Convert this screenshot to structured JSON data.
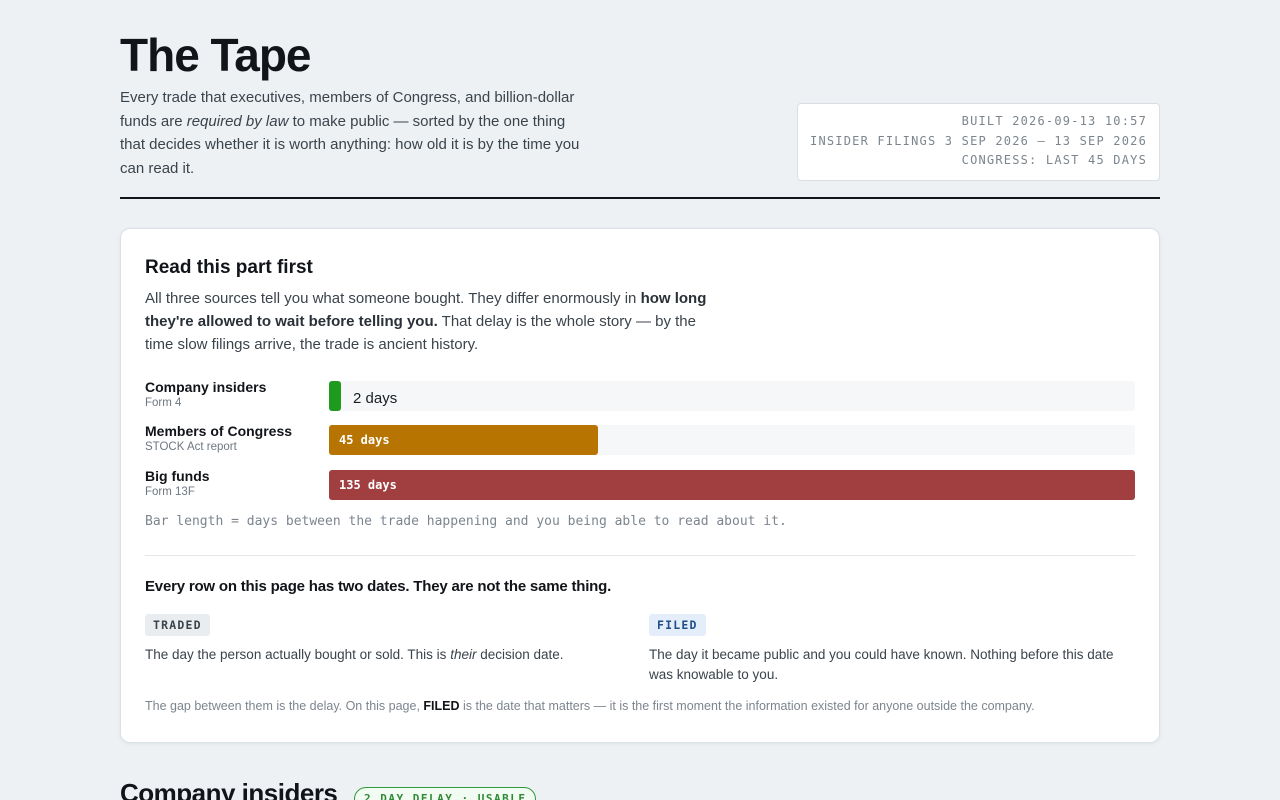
{
  "header": {
    "title": "The Tape",
    "intro_a": "Every trade that executives, members of Congress, and billion-dollar funds are ",
    "intro_em": "required by law",
    "intro_b": " to make public — sorted by the one thing that decides whether it is worth anything: how old it is by the time you can read it.",
    "meta_built": "BUILT 2026-09-13 10:57",
    "meta_insider": "INSIDER FILINGS 3 SEP 2026 – 13 SEP 2026",
    "meta_congress": "CONGRESS: LAST 45 DAYS"
  },
  "card": {
    "title": "Read this part first",
    "lead_a": "All three sources tell you what someone bought. They differ enormously in ",
    "lead_b": "how long they're allowed to wait before telling you.",
    "lead_c": " That delay is the whole story — by the time slow filings arrive, the trade is ancient history.",
    "delays": [
      {
        "name": "Company insiders",
        "form": "Form 4",
        "days": 2,
        "label": "2 days",
        "color": "#1e9a1e"
      },
      {
        "name": "Members of Congress",
        "form": "STOCK Act report",
        "days": 45,
        "label": "45 days",
        "color": "#b87400"
      },
      {
        "name": "Big funds",
        "form": "Form 13F",
        "days": 135,
        "label": "135 days",
        "color": "#a03e40"
      }
    ],
    "note": "Bar length = days between the trade happening and you being able to read about it.",
    "dates_title": "Every row on this page has two dates. They are not the same thing.",
    "traded": {
      "tag": "TRADED",
      "desc_a": "The day the person actually bought or sold. This is ",
      "desc_em": "their",
      "desc_b": " decision date."
    },
    "filed": {
      "tag": "FILED",
      "desc": "The day it became public and you could have known. Nothing before this date was knowable to you."
    },
    "gap_a": "The gap between them is the delay. On this page, ",
    "gap_b": "FILED",
    "gap_c": " is the date that matters — it is the first moment the information existed for anyone outside the company."
  },
  "next_section": {
    "title": "Company insiders",
    "badge": "2 DAY DELAY · USABLE"
  }
}
